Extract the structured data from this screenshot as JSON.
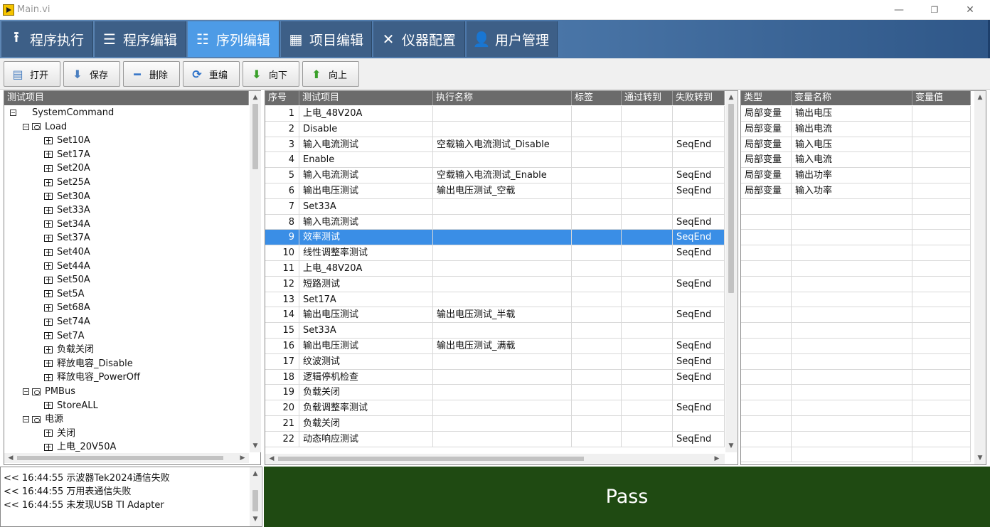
{
  "window": {
    "title": "Main.vi"
  },
  "tabs": [
    {
      "label": "程序执行",
      "icon": "upload-icon",
      "glyph": "⭱"
    },
    {
      "label": "程序编辑",
      "icon": "sliders-icon",
      "glyph": "☰"
    },
    {
      "label": "序列编辑",
      "icon": "list-icon",
      "glyph": "☷"
    },
    {
      "label": "项目编辑",
      "icon": "grid-icon",
      "glyph": "▦"
    },
    {
      "label": "仪器配置",
      "icon": "tools-icon",
      "glyph": "✕"
    },
    {
      "label": "用户管理",
      "icon": "user-icon",
      "glyph": "👤"
    }
  ],
  "active_tab": "序列编辑",
  "toolbar": [
    {
      "label": "打开",
      "icon": "open-file-icon",
      "glyph": "▤",
      "color": "#4a7fc0"
    },
    {
      "label": "保存",
      "icon": "save-icon",
      "glyph": "⬇",
      "color": "#4a7fc0"
    },
    {
      "label": "删除",
      "icon": "minus-icon",
      "glyph": "━",
      "color": "#3a78c8"
    },
    {
      "label": "重编",
      "icon": "refresh-icon",
      "glyph": "⟳",
      "color": "#2a70c8"
    },
    {
      "label": "向下",
      "icon": "arrow-down-icon",
      "glyph": "⬇",
      "color": "#3aa02a"
    },
    {
      "label": "向上",
      "icon": "arrow-up-icon",
      "glyph": "⬆",
      "color": "#3aa02a"
    }
  ],
  "tree": {
    "header": "测试项目",
    "nodes": [
      {
        "label": "SystemCommand",
        "level": 0,
        "type": "root"
      },
      {
        "label": "Load",
        "level": 1,
        "type": "folder"
      },
      {
        "label": "Set10A",
        "level": 2,
        "type": "item"
      },
      {
        "label": "Set17A",
        "level": 2,
        "type": "item"
      },
      {
        "label": "Set20A",
        "level": 2,
        "type": "item"
      },
      {
        "label": "Set25A",
        "level": 2,
        "type": "item"
      },
      {
        "label": "Set30A",
        "level": 2,
        "type": "item"
      },
      {
        "label": "Set33A",
        "level": 2,
        "type": "item"
      },
      {
        "label": "Set34A",
        "level": 2,
        "type": "item"
      },
      {
        "label": "Set37A",
        "level": 2,
        "type": "item"
      },
      {
        "label": "Set40A",
        "level": 2,
        "type": "item"
      },
      {
        "label": "Set44A",
        "level": 2,
        "type": "item"
      },
      {
        "label": "Set50A",
        "level": 2,
        "type": "item"
      },
      {
        "label": "Set5A",
        "level": 2,
        "type": "item"
      },
      {
        "label": "Set68A",
        "level": 2,
        "type": "item"
      },
      {
        "label": "Set74A",
        "level": 2,
        "type": "item"
      },
      {
        "label": "Set7A",
        "level": 2,
        "type": "item"
      },
      {
        "label": "负载关闭",
        "level": 2,
        "type": "item"
      },
      {
        "label": "释放电容_Disable",
        "level": 2,
        "type": "item"
      },
      {
        "label": "释放电容_PowerOff",
        "level": 2,
        "type": "item"
      },
      {
        "label": "PMBus",
        "level": 1,
        "type": "folder"
      },
      {
        "label": "StoreALL",
        "level": 2,
        "type": "item"
      },
      {
        "label": "电源",
        "level": 1,
        "type": "folder"
      },
      {
        "label": "关闭",
        "level": 2,
        "type": "item"
      },
      {
        "label": "上电_20V50A",
        "level": 2,
        "type": "item"
      }
    ]
  },
  "sequence": {
    "columns": [
      "序号",
      "测试项目",
      "执行名称",
      "标签",
      "通过转到",
      "失败转到"
    ],
    "selected_index": 9,
    "rows": [
      [
        "1",
        "上电_48V20A",
        "",
        "",
        "",
        ""
      ],
      [
        "2",
        "Disable",
        "",
        "",
        "",
        ""
      ],
      [
        "3",
        "输入电流测试",
        "空载输入电流测试_Disable",
        "",
        "",
        "SeqEnd"
      ],
      [
        "4",
        "Enable",
        "",
        "",
        "",
        ""
      ],
      [
        "5",
        "输入电流测试",
        "空载输入电流测试_Enable",
        "",
        "",
        "SeqEnd"
      ],
      [
        "6",
        "输出电压测试",
        "输出电压测试_空载",
        "",
        "",
        "SeqEnd"
      ],
      [
        "7",
        "Set33A",
        "",
        "",
        "",
        ""
      ],
      [
        "8",
        "输入电流测试",
        "",
        "",
        "",
        "SeqEnd"
      ],
      [
        "9",
        "效率测试",
        "",
        "",
        "",
        "SeqEnd"
      ],
      [
        "10",
        "线性调整率测试",
        "",
        "",
        "",
        "SeqEnd"
      ],
      [
        "11",
        "上电_48V20A",
        "",
        "",
        "",
        ""
      ],
      [
        "12",
        "短路测试",
        "",
        "",
        "",
        "SeqEnd"
      ],
      [
        "13",
        "Set17A",
        "",
        "",
        "",
        ""
      ],
      [
        "14",
        "输出电压测试",
        "输出电压测试_半载",
        "",
        "",
        "SeqEnd"
      ],
      [
        "15",
        "Set33A",
        "",
        "",
        "",
        ""
      ],
      [
        "16",
        "输出电压测试",
        "输出电压测试_满载",
        "",
        "",
        "SeqEnd"
      ],
      [
        "17",
        "纹波测试",
        "",
        "",
        "",
        "SeqEnd"
      ],
      [
        "18",
        "逻辑停机检查",
        "",
        "",
        "",
        "SeqEnd"
      ],
      [
        "19",
        "负载关闭",
        "",
        "",
        "",
        ""
      ],
      [
        "20",
        "负载调整率测试",
        "",
        "",
        "",
        "SeqEnd"
      ],
      [
        "21",
        "负载关闭",
        "",
        "",
        "",
        ""
      ],
      [
        "22",
        "动态响应测试",
        "",
        "",
        "",
        "SeqEnd"
      ]
    ]
  },
  "variables": {
    "columns": [
      "类型",
      "变量名称",
      "变量值"
    ],
    "rows": [
      [
        "局部变量",
        "输出电压",
        ""
      ],
      [
        "局部变量",
        "输出电流",
        ""
      ],
      [
        "局部变量",
        "输入电压",
        ""
      ],
      [
        "局部变量",
        "输入电流",
        ""
      ],
      [
        "局部变量",
        "输出功率",
        ""
      ],
      [
        "局部变量",
        "输入功率",
        ""
      ]
    ]
  },
  "log": {
    "lines": [
      "<< 16:44:55 示波器Tek2024通信失败",
      "<< 16:44:55 万用表通信失败",
      "<< 16:44:55 未发现USB TI Adapter"
    ]
  },
  "status": {
    "text": "Pass",
    "color": "#1f4a12"
  }
}
